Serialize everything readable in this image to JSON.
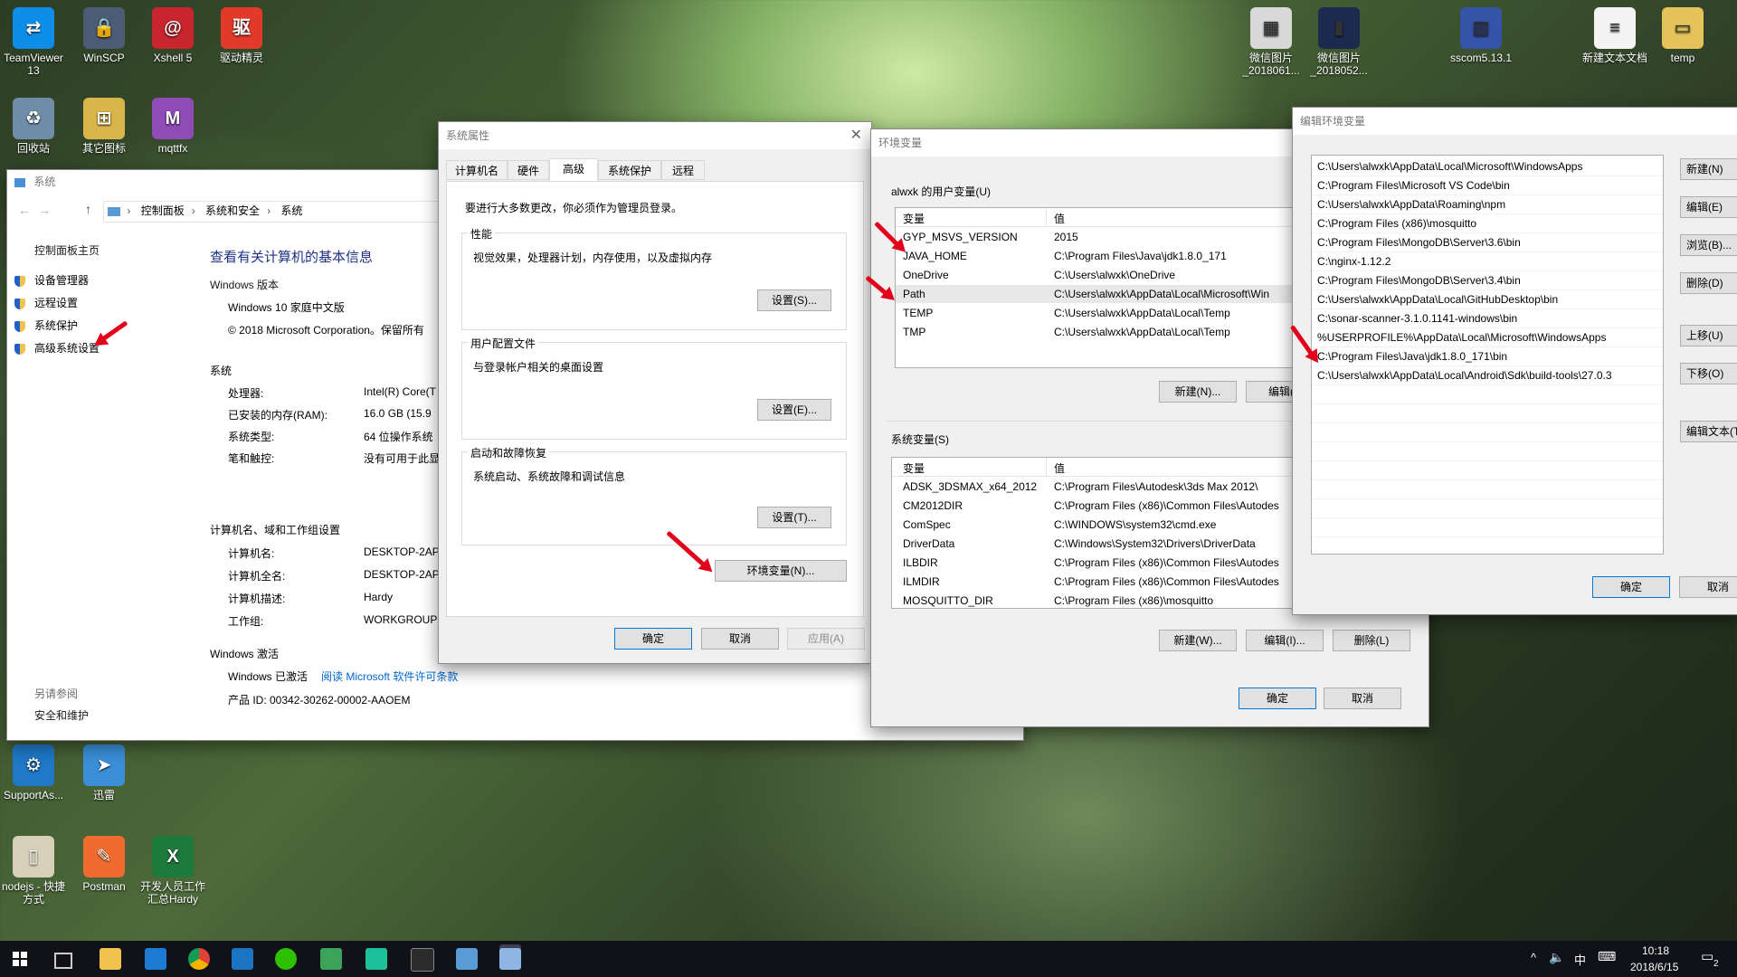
{
  "desktop": {
    "icons_left": [
      {
        "label": "TeamViewer 13",
        "color": "#0e8ee9",
        "glyph": "⇄"
      },
      {
        "label": "WinSCP",
        "color": "#4b5c74",
        "glyph": "🔒"
      },
      {
        "label": "Xshell 5",
        "color": "#c8252f",
        "glyph": "@"
      },
      {
        "label": "驱动精灵",
        "color": "#e23a2a",
        "glyph": "驱"
      },
      {
        "label": "回收站",
        "color": "#6f8da8",
        "glyph": "♻"
      },
      {
        "label": "其它图标",
        "color": "#d9b54a",
        "glyph": "⊞"
      },
      {
        "label": "mqttfx",
        "color": "#8f4bb6",
        "glyph": "M"
      },
      {
        "label": "SupportAs...",
        "color": "#1f78c8",
        "glyph": "⚙"
      },
      {
        "label": "迅雷",
        "color": "#3b8fd9",
        "glyph": "➤"
      },
      {
        "label": "nodejs - 快捷方式",
        "color": "#d6d0b8",
        "glyph": "▯"
      },
      {
        "label": "Postman",
        "color": "#ef6c2e",
        "glyph": "✎"
      },
      {
        "label": "开发人员工作汇总Hardy",
        "color": "#1d7a3d",
        "glyph": "X"
      }
    ],
    "icons_right": [
      {
        "label": "微信图片_2018061...",
        "color": "#d8d8d8",
        "glyph": "▦"
      },
      {
        "label": "微信图片_2018052...",
        "color": "#1b2b50",
        "glyph": "▮"
      },
      {
        "label": "sscom5.13.1",
        "color": "#3553a8",
        "glyph": "▥"
      },
      {
        "label": "新建文本文档",
        "color": "#f4f4f4",
        "glyph": "≡"
      },
      {
        "label": "temp",
        "color": "#e6c35a",
        "glyph": "▭"
      }
    ]
  },
  "system_window": {
    "title": "系统",
    "breadcrumb": [
      "控制面板",
      "系统和安全",
      "系统"
    ],
    "left_nav": {
      "home": "控制面板主页",
      "items": [
        "设备管理器",
        "远程设置",
        "系统保护",
        "高级系统设置"
      ],
      "see_also": "另请参阅",
      "see_also_items": [
        "安全和维护"
      ]
    },
    "heading": "查看有关计算机的基本信息",
    "win_edition_label": "Windows 版本",
    "edition": "Windows 10 家庭中文版",
    "copyright": "© 2018 Microsoft Corporation。保留所有",
    "system_label": "系统",
    "system_rows": [
      {
        "k": "处理器:",
        "v": "Intel(R) Core(T"
      },
      {
        "k": "已安装的内存(RAM):",
        "v": "16.0 GB (15.9"
      },
      {
        "k": "系统类型:",
        "v": "64 位操作系统"
      },
      {
        "k": "笔和触控:",
        "v": "没有可用于此显"
      }
    ],
    "name_label": "计算机名、域和工作组设置",
    "name_rows": [
      {
        "k": "计算机名:",
        "v": "DESKTOP-2AP"
      },
      {
        "k": "计算机全名:",
        "v": "DESKTOP-2AP"
      },
      {
        "k": "计算机描述:",
        "v": "Hardy"
      },
      {
        "k": "工作组:",
        "v": "WORKGROUP"
      }
    ],
    "activation_label": "Windows 激活",
    "activated": "Windows 已激活",
    "license_link": "阅读 Microsoft 软件许可条款",
    "product_id": "产品 ID: 00342-30262-00002-AAOEM"
  },
  "sysprops": {
    "title": "系统属性",
    "tabs": [
      "计算机名",
      "硬件",
      "高级",
      "系统保护",
      "远程"
    ],
    "active_tab": "高级",
    "admin_note": "要进行大多数更改，你必须作为管理员登录。",
    "perf": {
      "label": "性能",
      "desc": "视觉效果，处理器计划，内存使用，以及虚拟内存",
      "button": "设置(S)..."
    },
    "profile": {
      "label": "用户配置文件",
      "desc": "与登录帐户相关的桌面设置",
      "button": "设置(E)..."
    },
    "startup": {
      "label": "启动和故障恢复",
      "desc": "系统启动、系统故障和调试信息",
      "button": "设置(T)..."
    },
    "env_button": "环境变量(N)...",
    "ok": "确定",
    "cancel": "取消",
    "apply": "应用(A)"
  },
  "envvars": {
    "title": "环境变量",
    "user_label": "alwxk 的用户变量(U)",
    "col_var": "变量",
    "col_val": "值",
    "user_vars": [
      {
        "k": "GYP_MSVS_VERSION",
        "v": "2015"
      },
      {
        "k": "JAVA_HOME",
        "v": "C:\\Program Files\\Java\\jdk1.8.0_171"
      },
      {
        "k": "OneDrive",
        "v": "C:\\Users\\alwxk\\OneDrive"
      },
      {
        "k": "Path",
        "v": "C:\\Users\\alwxk\\AppData\\Local\\Microsoft\\Win"
      },
      {
        "k": "TEMP",
        "v": "C:\\Users\\alwxk\\AppData\\Local\\Temp"
      },
      {
        "k": "TMP",
        "v": "C:\\Users\\alwxk\\AppData\\Local\\Temp"
      }
    ],
    "user_new": "新建(N)...",
    "user_edit": "编辑(E",
    "sys_label": "系统变量(S)",
    "sys_vars": [
      {
        "k": "ADSK_3DSMAX_x64_2012",
        "v": "C:\\Program Files\\Autodesk\\3ds Max 2012\\"
      },
      {
        "k": "CM2012DIR",
        "v": "C:\\Program Files (x86)\\Common Files\\Autodes"
      },
      {
        "k": "ComSpec",
        "v": "C:\\WINDOWS\\system32\\cmd.exe"
      },
      {
        "k": "DriverData",
        "v": "C:\\Windows\\System32\\Drivers\\DriverData"
      },
      {
        "k": "ILBDIR",
        "v": "C:\\Program Files (x86)\\Common Files\\Autodes"
      },
      {
        "k": "ILMDIR",
        "v": "C:\\Program Files (x86)\\Common Files\\Autodes"
      },
      {
        "k": "MOSQUITTO_DIR",
        "v": "C:\\Program Files (x86)\\mosquitto"
      }
    ],
    "sys_new": "新建(W)...",
    "sys_edit": "编辑(I)...",
    "sys_delete": "删除(L)",
    "ok": "确定",
    "cancel": "取消"
  },
  "editenv": {
    "title": "编辑环境变量",
    "paths": [
      "C:\\Users\\alwxk\\AppData\\Local\\Microsoft\\WindowsApps",
      "C:\\Program Files\\Microsoft VS Code\\bin",
      "C:\\Users\\alwxk\\AppData\\Roaming\\npm",
      "C:\\Program Files (x86)\\mosquitto",
      "C:\\Program Files\\MongoDB\\Server\\3.6\\bin",
      "C:\\nginx-1.12.2",
      "C:\\Program Files\\MongoDB\\Server\\3.4\\bin",
      "C:\\Users\\alwxk\\AppData\\Local\\GitHubDesktop\\bin",
      "C:\\sonar-scanner-3.1.0.1141-windows\\bin",
      "%USERPROFILE%\\AppData\\Local\\Microsoft\\WindowsApps",
      "C:\\Program Files\\Java\\jdk1.8.0_171\\bin",
      "C:\\Users\\alwxk\\AppData\\Local\\Android\\Sdk\\build-tools\\27.0.3"
    ],
    "buttons": [
      "新建(N)",
      "编辑(E)",
      "浏览(B)...",
      "删除(D)",
      "上移(U)",
      "下移(O)",
      "编辑文本(T"
    ],
    "ok": "确定",
    "cancel": "取消"
  },
  "taskbar": {
    "time": "10:18",
    "date": "2018/6/15",
    "ime": "中",
    "notif_count": "2"
  },
  "colors": {
    "accent": "#0078d7",
    "link": "#0066cc",
    "arrow": "#e3001b"
  }
}
